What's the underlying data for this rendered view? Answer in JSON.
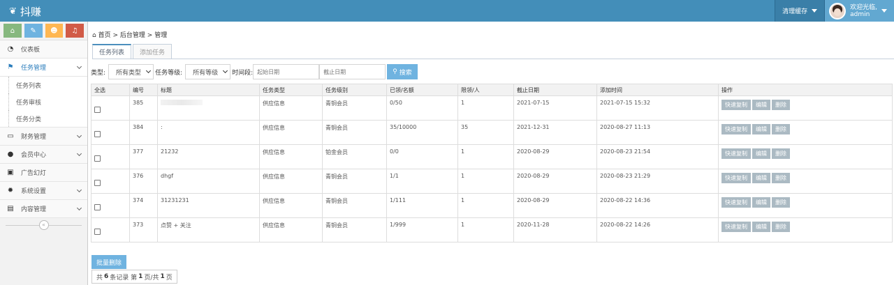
{
  "app": {
    "title": "抖赚"
  },
  "header": {
    "cache_label": "清理缓存",
    "welcome": "欢迎光临,",
    "username": "admin"
  },
  "sidebar": {
    "items": [
      {
        "label": "仪表板",
        "icon": "dashboard-icon"
      },
      {
        "label": "任务管理",
        "icon": "flag-icon",
        "open": true,
        "children": [
          "任务列表",
          "任务审核",
          "任务分类"
        ]
      },
      {
        "label": "财务管理",
        "icon": "finance-icon"
      },
      {
        "label": "会员中心",
        "icon": "user-icon"
      },
      {
        "label": "广告幻灯",
        "icon": "picture-icon"
      },
      {
        "label": "系统设置",
        "icon": "cog-icon"
      },
      {
        "label": "内容管理",
        "icon": "book-icon"
      }
    ],
    "collapse_glyph": "«"
  },
  "breadcrumb": {
    "home": "首页",
    "sep1": ">",
    "level1": "后台管理",
    "sep2": ">",
    "level2": "管理"
  },
  "tabs": [
    "任务列表",
    "添加任务"
  ],
  "filters": {
    "type_label": "类型:",
    "type_value": "所有类型",
    "level_label": "任务等级:",
    "level_value": "所有等级",
    "period_label": "时间段:",
    "start_placeholder": "起始日期",
    "end_placeholder": "截止日期",
    "search_label": "搜索"
  },
  "table": {
    "columns": [
      "全选",
      "编号",
      "标题",
      "任务类型",
      "任务级别",
      "已领/名额",
      "限领/人",
      "截止日期",
      "添加时间",
      "操作"
    ],
    "rows": [
      {
        "id": "385",
        "title": "",
        "type": "供应信息",
        "level": "青铜会员",
        "quota": "0/50",
        "limit": "1",
        "deadline": "2021-07-15",
        "added": "2021-07-15 15:32"
      },
      {
        "id": "384",
        "title": ":",
        "type": "供应信息",
        "level": "青铜会员",
        "quota": "35/10000",
        "limit": "35",
        "deadline": "2021-12-31",
        "added": "2020-08-27 11:13"
      },
      {
        "id": "377",
        "title": "21232",
        "type": "供应信息",
        "level": "铂金会员",
        "quota": "0/0",
        "limit": "1",
        "deadline": "2020-08-29",
        "added": "2020-08-23 21:54"
      },
      {
        "id": "376",
        "title": "dhgf",
        "type": "供应信息",
        "level": "青铜会员",
        "quota": "1/1",
        "limit": "1",
        "deadline": "2020-08-29",
        "added": "2020-08-23 21:29"
      },
      {
        "id": "374",
        "title": "31231231",
        "type": "供应信息",
        "level": "青铜会员",
        "quota": "1/111",
        "limit": "1",
        "deadline": "2020-08-29",
        "added": "2020-08-22 14:36"
      },
      {
        "id": "373",
        "title": "点赞 + 关注",
        "type": "供应信息",
        "level": "青铜会员",
        "quota": "1/999",
        "limit": "1",
        "deadline": "2020-11-28",
        "added": "2020-08-22 14:26"
      }
    ],
    "actions": [
      "快速复制",
      "编辑",
      "删除"
    ]
  },
  "batch_delete_label": "批量删除",
  "pager": {
    "prefix": "共",
    "total": "6",
    "mid": "条记录 第",
    "page": "1",
    "sep": "页/共",
    "pages": "1",
    "suffix": "页"
  },
  "colors": {
    "navbar": "#438eb9",
    "accent": "#6fb3e0",
    "action_btn": "#abbac3"
  }
}
